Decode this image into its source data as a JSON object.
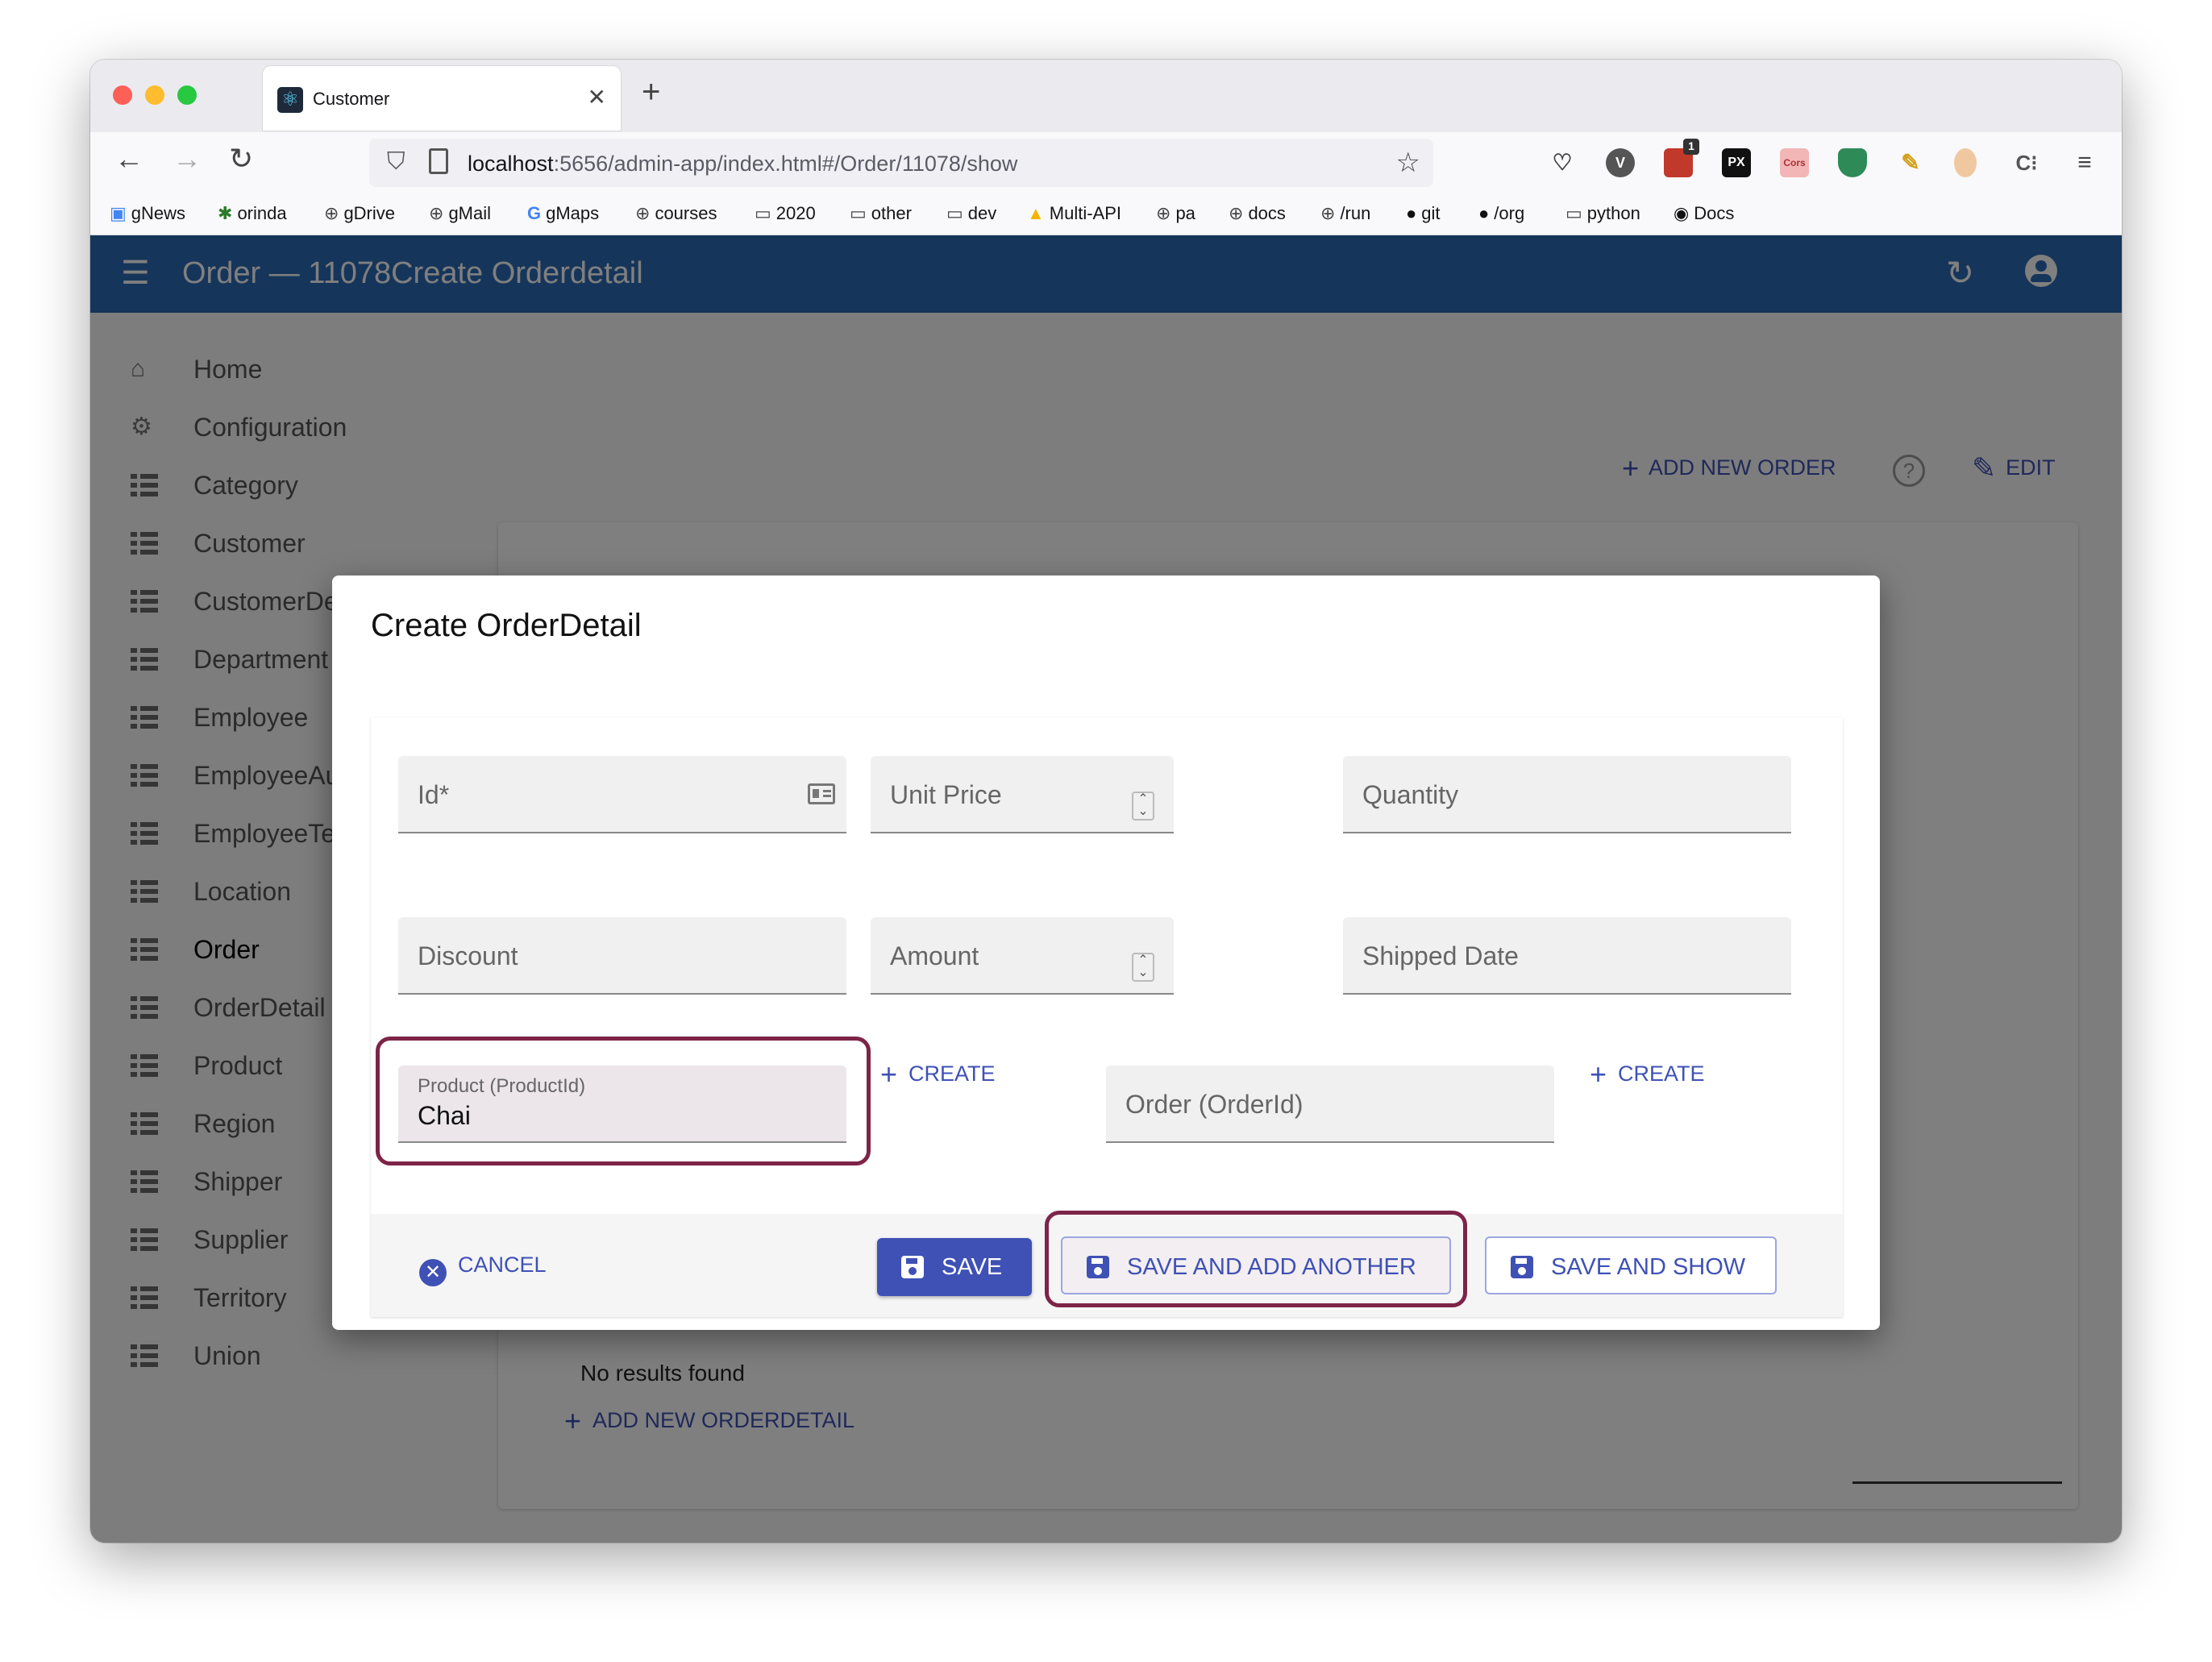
{
  "browser": {
    "tab_title": "Customer",
    "url_host": "localhost",
    "url_rest": ":5656/admin-app/index.html#/Order/11078/show",
    "bookmarks": [
      "gNews",
      "orinda",
      "gDrive",
      "gMail",
      "gMaps",
      "courses",
      "2020",
      "other",
      "dev",
      "Multi-API",
      "pa",
      "docs",
      "/run",
      "git",
      "/org",
      "python",
      "Docs"
    ],
    "extension_badge": "1"
  },
  "app": {
    "title": "Order — 11078Create Orderdetail"
  },
  "sidebar": {
    "items": [
      {
        "label": "Home"
      },
      {
        "label": "Configuration"
      },
      {
        "label": "Category"
      },
      {
        "label": "Customer"
      },
      {
        "label": "CustomerDe"
      },
      {
        "label": "Department"
      },
      {
        "label": "Employee"
      },
      {
        "label": "EmployeeAu"
      },
      {
        "label": "EmployeeTe"
      },
      {
        "label": "Location"
      },
      {
        "label": "Order"
      },
      {
        "label": "OrderDetail"
      },
      {
        "label": "Product"
      },
      {
        "label": "Region"
      },
      {
        "label": "Shipper"
      },
      {
        "label": "Supplier"
      },
      {
        "label": "Territory"
      },
      {
        "label": "Union"
      }
    ],
    "active": "Order"
  },
  "show_page": {
    "add_new_order": "ADD NEW ORDER",
    "edit": "EDIT",
    "no_results": "No results found",
    "add_new_orderdetail": "ADD NEW ORDERDETAIL"
  },
  "dialog": {
    "title": "Create OrderDetail",
    "fields": {
      "id": {
        "label": "Id*"
      },
      "unit_price": {
        "label": "Unit Price"
      },
      "quantity": {
        "label": "Quantity"
      },
      "discount": {
        "label": "Discount"
      },
      "amount": {
        "label": "Amount"
      },
      "shipped_date": {
        "label": "Shipped Date"
      },
      "product": {
        "label": "Product (ProductId)",
        "value": "Chai"
      },
      "order": {
        "label": "Order (OrderId)"
      }
    },
    "create_label": "CREATE",
    "buttons": {
      "cancel": "CANCEL",
      "save": "SAVE",
      "save_and_add": "SAVE AND ADD ANOTHER",
      "save_and_show": "SAVE AND SHOW"
    }
  },
  "colors": {
    "appbar": "#2d6ab4",
    "primary": "#3f51b5",
    "highlight": "#7d2448"
  }
}
